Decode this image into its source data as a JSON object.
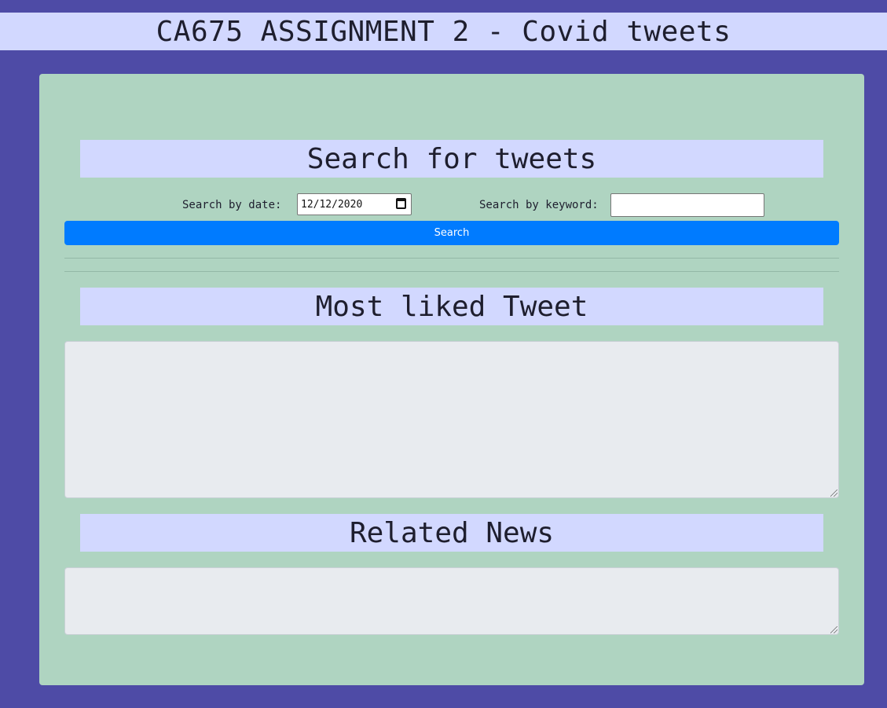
{
  "header": {
    "title": "CA675 ASSIGNMENT 2 - Covid tweets"
  },
  "search": {
    "heading": "Search for tweets",
    "date_label": "Search by date:",
    "date_value": "12/12/2020",
    "keyword_label": "Search by keyword:",
    "keyword_value": "",
    "button_label": "Search"
  },
  "most_liked": {
    "heading": "Most liked Tweet",
    "content": ""
  },
  "related_news": {
    "heading": "Related News",
    "content": ""
  },
  "colors": {
    "background": "#4e4ba6",
    "header_bar": "#d2d8ff",
    "card": "#afd4c1",
    "button": "#007bff",
    "textarea": "#e8ebef"
  },
  "icons": {
    "date_picker": "calendar-icon",
    "textarea_resize": "resize-grip-icon"
  }
}
